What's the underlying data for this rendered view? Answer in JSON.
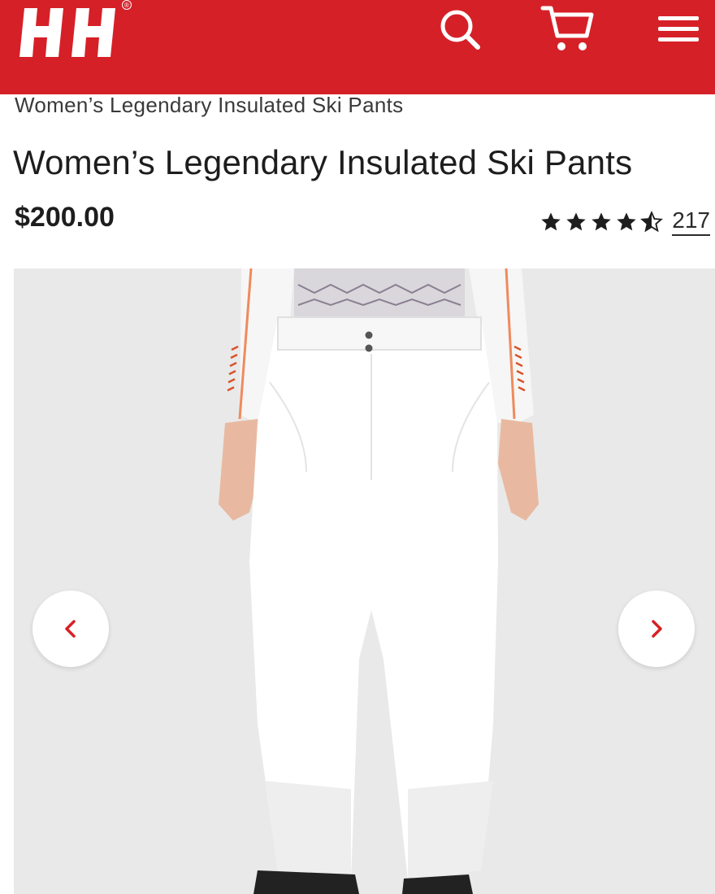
{
  "header": {
    "brand": "HH",
    "registered_mark": "®",
    "background_color": "#d62027",
    "icons": [
      "search-icon",
      "cart-icon",
      "menu-icon"
    ]
  },
  "breadcrumb": "Women’s Legendary Insulated Ski Pants",
  "product": {
    "title": "Women’s Legendary Insulated Ski Pants",
    "price": "$200.00",
    "rating": 4.5,
    "rating_max": 5,
    "review_count": "217"
  },
  "gallery": {
    "prev_icon": "chevron-left-icon",
    "next_icon": "chevron-right-icon",
    "accent_color": "#d62027"
  }
}
